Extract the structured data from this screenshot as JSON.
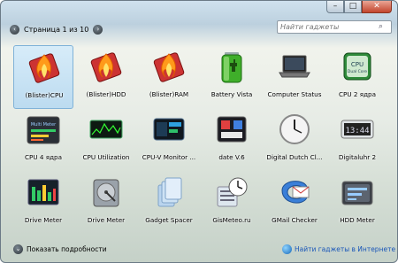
{
  "window": {
    "minimize": "–",
    "maximize": "□",
    "close": "✕"
  },
  "nav": {
    "prev": "‹",
    "next": "›",
    "page_label": "Страница 1 из 10"
  },
  "search": {
    "placeholder": "Найти гаджеты",
    "icon": "search-icon"
  },
  "gadgets": [
    {
      "name": "(Blister)CPU",
      "icon": "flame-icon",
      "selected": true
    },
    {
      "name": "(Blister)HDD",
      "icon": "flame-icon"
    },
    {
      "name": "(Blister)RAM",
      "icon": "flame-icon"
    },
    {
      "name": "Battery Vista",
      "icon": "battery-icon"
    },
    {
      "name": "Computer Status",
      "icon": "laptop-icon"
    },
    {
      "name": "CPU 2 ядра",
      "icon": "cpu-dual-core-icon"
    },
    {
      "name": "CPU 4 ядра",
      "icon": "multi-meter-icon"
    },
    {
      "name": "CPU Utilization",
      "icon": "cpu-graph-icon"
    },
    {
      "name": "CPU-V Monitor ...",
      "icon": "cpu-monitor-icon"
    },
    {
      "name": "date V.6",
      "icon": "date-icon"
    },
    {
      "name": "Digital Dutch Cl...",
      "icon": "clock-icon"
    },
    {
      "name": "Digitaluhr 2",
      "icon": "digital-clock-icon"
    },
    {
      "name": "Drive Meter",
      "icon": "drive-meter-icon"
    },
    {
      "name": "Drive Meter",
      "icon": "hard-drive-icon"
    },
    {
      "name": "Gadget Spacer",
      "icon": "spacer-icon"
    },
    {
      "name": "GisMeteo.ru",
      "icon": "weather-icon"
    },
    {
      "name": "GMail Checker",
      "icon": "mail-icon"
    },
    {
      "name": "HDD Meter",
      "icon": "hdd-meter-icon"
    }
  ],
  "icon_texts": {
    "cpu_core": "CPU",
    "cpu_core_sub": "Dual Core",
    "multi_meter": "Multi Meter",
    "clock": "13:44"
  },
  "footer": {
    "details_label": "Показать подробности",
    "online_label": "Найти гаджеты в Интернете"
  },
  "colors": {
    "accent": "#1a56b8",
    "selection": "#bcdbf0"
  }
}
